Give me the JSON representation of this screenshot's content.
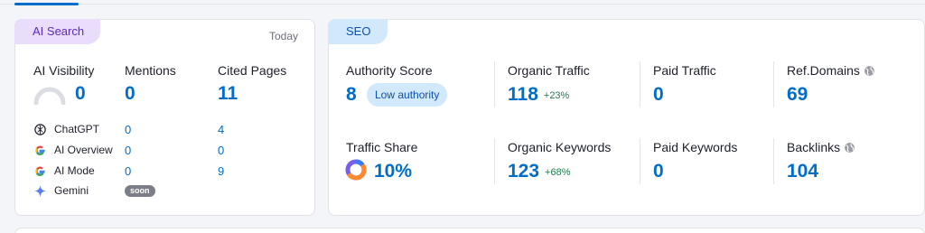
{
  "ai": {
    "tag": "AI Search",
    "date": "Today",
    "metrics": {
      "visibility_label": "AI Visibility",
      "visibility_value": "0",
      "mentions_label": "Mentions",
      "mentions_value": "0",
      "cited_label": "Cited Pages",
      "cited_value": "11"
    },
    "sources": [
      {
        "name": "ChatGPT",
        "mentions": "0",
        "cited": "4"
      },
      {
        "name": "AI Overview",
        "mentions": "0",
        "cited": "0"
      },
      {
        "name": "AI Mode",
        "mentions": "0",
        "cited": "9"
      },
      {
        "name": "Gemini",
        "soon": "soon"
      }
    ]
  },
  "seo": {
    "tag": "SEO",
    "authority_label": "Authority Score",
    "authority_value": "8",
    "authority_badge": "Low authority",
    "organic_traffic_label": "Organic Traffic",
    "organic_traffic_value": "118",
    "organic_traffic_delta": "+23%",
    "paid_traffic_label": "Paid Traffic",
    "paid_traffic_value": "0",
    "ref_domains_label": "Ref.Domains",
    "ref_domains_value": "69",
    "traffic_share_label": "Traffic Share",
    "traffic_share_value": "10%",
    "organic_keywords_label": "Organic Keywords",
    "organic_keywords_value": "123",
    "organic_keywords_delta": "+68%",
    "paid_keywords_label": "Paid Keywords",
    "paid_keywords_value": "0",
    "backlinks_label": "Backlinks",
    "backlinks_value": "104"
  },
  "colors": {
    "accent_blue": "#006dca",
    "ai_tag_bg": "#eadcfb",
    "seo_tag_bg": "#d1e9fb",
    "positive_green": "#1f7a4d"
  }
}
